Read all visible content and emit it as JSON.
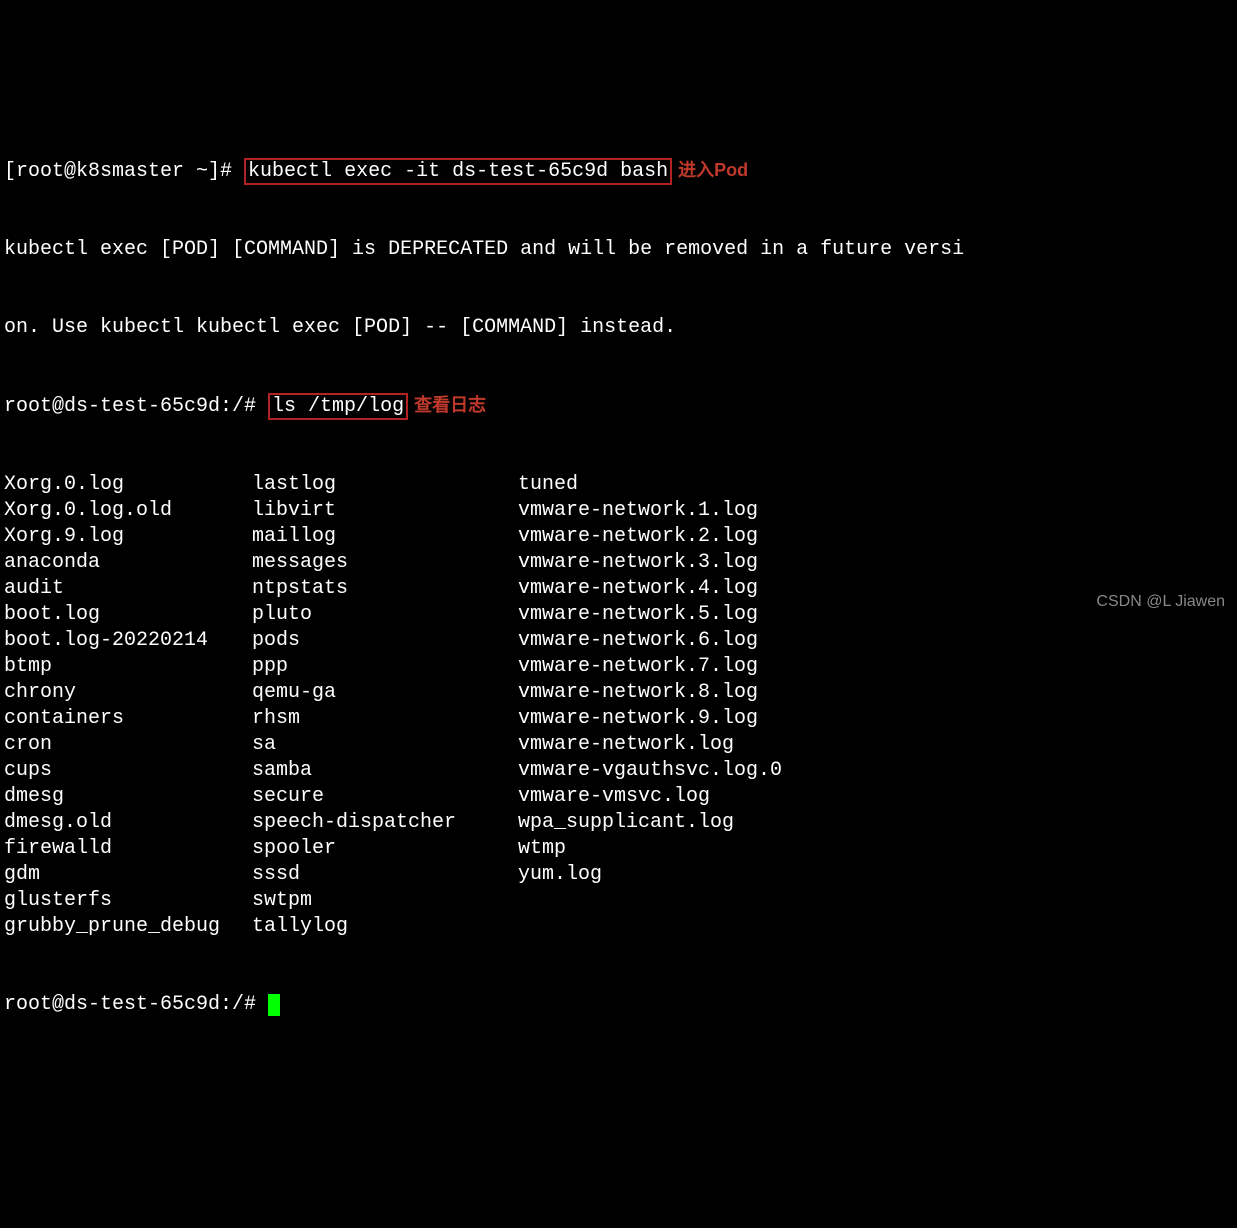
{
  "prompt1_prefix": "[root@k8smaster ~]# ",
  "command1": "kubectl exec -it ds-test-65c9d bash",
  "annotation1": "进入Pod",
  "deprec_line1": "kubectl exec [POD] [COMMAND] is DEPRECATED and will be removed in a future versi",
  "deprec_line2": "on. Use kubectl kubectl exec [POD] -- [COMMAND] instead.",
  "prompt2_prefix": "root@ds-test-65c9d:/# ",
  "command2": "ls /tmp/log",
  "annotation2": "查看日志",
  "listing": [
    [
      "Xorg.0.log",
      "lastlog",
      "tuned"
    ],
    [
      "Xorg.0.log.old",
      "libvirt",
      "vmware-network.1.log"
    ],
    [
      "Xorg.9.log",
      "maillog",
      "vmware-network.2.log"
    ],
    [
      "anaconda",
      "messages",
      "vmware-network.3.log"
    ],
    [
      "audit",
      "ntpstats",
      "vmware-network.4.log"
    ],
    [
      "boot.log",
      "pluto",
      "vmware-network.5.log"
    ],
    [
      "boot.log-20220214",
      "pods",
      "vmware-network.6.log"
    ],
    [
      "btmp",
      "ppp",
      "vmware-network.7.log"
    ],
    [
      "chrony",
      "qemu-ga",
      "vmware-network.8.log"
    ],
    [
      "containers",
      "rhsm",
      "vmware-network.9.log"
    ],
    [
      "cron",
      "sa",
      "vmware-network.log"
    ],
    [
      "cups",
      "samba",
      "vmware-vgauthsvc.log.0"
    ],
    [
      "dmesg",
      "secure",
      "vmware-vmsvc.log"
    ],
    [
      "dmesg.old",
      "speech-dispatcher",
      "wpa_supplicant.log"
    ],
    [
      "firewalld",
      "spooler",
      "wtmp"
    ],
    [
      "gdm",
      "sssd",
      "yum.log"
    ],
    [
      "glusterfs",
      "swtpm",
      ""
    ],
    [
      "grubby_prune_debug",
      "tallylog",
      ""
    ]
  ],
  "prompt3": "root@ds-test-65c9d:/# ",
  "watermark": "CSDN @L Jiawen"
}
